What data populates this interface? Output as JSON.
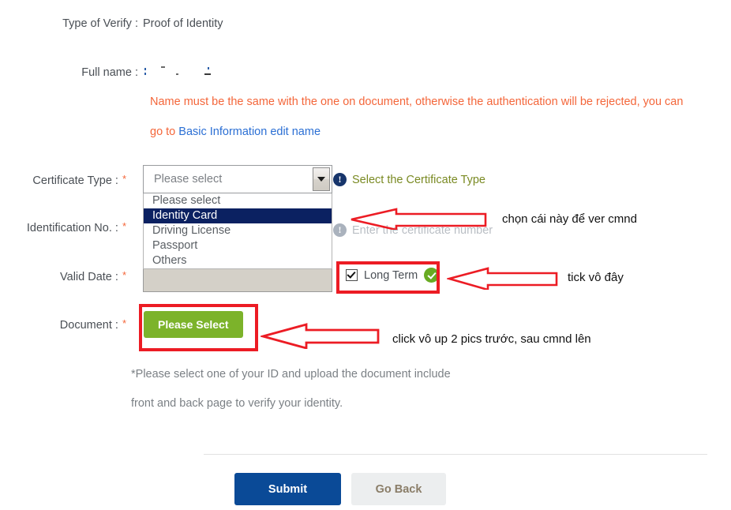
{
  "form": {
    "rows": {
      "type_of_verify": {
        "label": "Type of Verify :",
        "value": "Proof of Identity"
      },
      "full_name": {
        "label": "Full name :",
        "value": ""
      },
      "certificate_type": {
        "label": "Certificate Type :",
        "required": "*"
      },
      "identification_no": {
        "label": "Identification No. :",
        "required": "*"
      },
      "valid_date": {
        "label": "Valid Date :",
        "required": "*"
      },
      "document": {
        "label": "Document :",
        "required": "*"
      }
    },
    "name_notice": {
      "line1": "Name must be the same with the one on document, otherwise the authentication will be rejected, you can",
      "line2_prefix": "go to ",
      "line2_link": "Basic Information edit name"
    },
    "certificate_select": {
      "selected_text": "Please select",
      "options": [
        {
          "label": "Please select",
          "selected": false
        },
        {
          "label": "Identity Card",
          "selected": true
        },
        {
          "label": "Driving License",
          "selected": false
        },
        {
          "label": "Passport",
          "selected": false
        },
        {
          "label": "Others",
          "selected": false
        }
      ]
    },
    "hints": {
      "certificate_type": "Select the Certificate Type",
      "identification_no": "Enter the certificate number"
    },
    "long_term": {
      "label": "Long Term",
      "checked": true
    },
    "document_button": {
      "label": "Please Select"
    },
    "document_note": {
      "line1": "*Please select one of your ID and upload the document include",
      "line2": "front and back page to verify your identity."
    }
  },
  "annotations": [
    {
      "id": "annot-certificate",
      "text": "chọn cái này để ver cmnd"
    },
    {
      "id": "annot-longterm",
      "text": "tick vô đây"
    },
    {
      "id": "annot-document",
      "text": "click vô up 2 pics trước, sau cmnd lên"
    }
  ],
  "footer": {
    "submit_label": "Submit",
    "go_back_label": "Go Back"
  },
  "colors": {
    "notice_orange": "#f4663a",
    "link_blue": "#2b6fd4",
    "hint_olive": "#7a8a23",
    "hint_muted": "#b9bec4",
    "info_blue": "#17356b",
    "green_button": "#7cb32a",
    "green_check": "#68ab22",
    "annotation_red": "#ec1c24",
    "submit_blue": "#0a4a97",
    "option_selected_bg": "#0b2161"
  }
}
